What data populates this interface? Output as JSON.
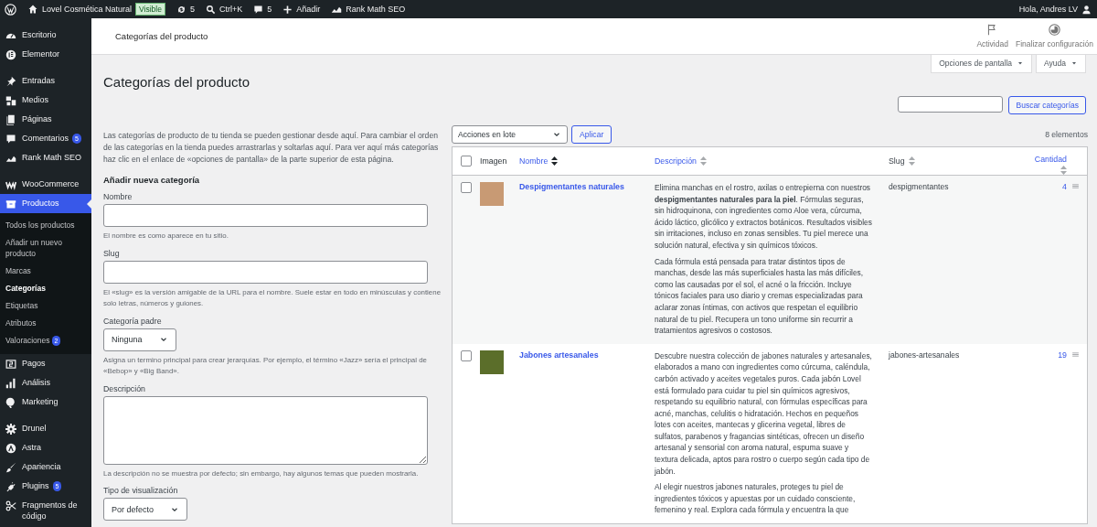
{
  "admin_bar": {
    "site_name": "Lovel Cosmética Natural",
    "site_badge": "Visible",
    "updates": "5",
    "search_shortcut": "Ctrl+K",
    "comments": "5",
    "new_label": "Añadir",
    "seo_label": "Rank Math SEO",
    "greeting": "Hola, Andres LV"
  },
  "sidebar": {
    "groups": [
      [
        {
          "label": "Escritorio",
          "selected": false
        },
        {
          "label": "Elementor",
          "selected": false
        }
      ],
      [
        {
          "label": "Entradas",
          "selected": false
        },
        {
          "label": "Medios",
          "selected": false
        },
        {
          "label": "Páginas",
          "selected": false
        },
        {
          "label": "Comentarios",
          "selected": false,
          "badge": "5"
        },
        {
          "label": "Rank Math SEO",
          "selected": false
        }
      ],
      [
        {
          "label": "WooCommerce",
          "selected": false
        },
        {
          "label": "Productos",
          "selected": true,
          "expanded": true,
          "children": [
            {
              "label": "Todos los productos",
              "selected": false
            },
            {
              "label": "Añadir un nuevo producto",
              "selected": false
            },
            {
              "label": "Marcas",
              "selected": false
            },
            {
              "label": "Categorías",
              "selected": true
            },
            {
              "label": "Etiquetas",
              "selected": false
            },
            {
              "label": "Atributos",
              "selected": false
            },
            {
              "label": "Valoraciones",
              "selected": false,
              "badge": "2"
            }
          ]
        },
        {
          "label": "Pagos",
          "selected": false
        },
        {
          "label": "Análisis",
          "selected": false
        },
        {
          "label": "Marketing",
          "selected": false
        }
      ],
      [
        {
          "label": "Drunel",
          "selected": false
        },
        {
          "label": "Astra",
          "selected": false
        },
        {
          "label": "Apariencia",
          "selected": false
        },
        {
          "label": "Plugins",
          "selected": false,
          "badge": "5"
        },
        {
          "label": "Fragmentos de código",
          "selected": false
        }
      ]
    ]
  },
  "header": {
    "title": "Categorías del producto",
    "actions": [
      {
        "label": "Actividad"
      },
      {
        "label": "Finalizar configuración"
      }
    ]
  },
  "screen_meta": [
    {
      "label": "Opciones de pantalla"
    },
    {
      "label": "Ayuda"
    }
  ],
  "page_title": "Categorías del producto",
  "search": {
    "button": "Buscar categorías"
  },
  "intro": "Las categorías de producto de tu tienda se pueden gestionar desde aquí. Para cambiar el orden de las categorías en la tienda puedes arrastrarlas y soltarlas aquí. Para ver aquí más categorías haz clic en el enlace de «opciones de pantalla» de la parte superior de esta página.",
  "form": {
    "heading": "Añadir nueva categoría",
    "fields": [
      {
        "kind": "text",
        "label": "Nombre",
        "help": "El nombre es como aparece en tu sitio."
      },
      {
        "kind": "text",
        "label": "Slug",
        "help": "El «slug» es la versión amigable de la URL para el nombre. Suele estar en todo en minúsculas y contiene solo letras, números y guiones."
      },
      {
        "kind": "select",
        "label": "Categoría padre",
        "value": "Ninguna",
        "help": "Asigna un termino principal para crear jerarquías. Por ejemplo, el término «Jazz» sería el principal de «Bebop» y «Big Band»."
      },
      {
        "kind": "textarea",
        "label": "Descripción",
        "help": "La descripción no se muestra por defecto; sin embargo, hay algunos temas que pueden mostrarla."
      },
      {
        "kind": "select",
        "label": "Tipo de visualización",
        "value": "Por defecto"
      }
    ]
  },
  "table": {
    "bulk_action": "Acciones en lote",
    "apply": "Aplicar",
    "count": "8 elementos",
    "select_all_checked": false,
    "columns": [
      {
        "label": "Imagen",
        "sortable": false
      },
      {
        "label": "Nombre",
        "sortable": true,
        "sorted": true
      },
      {
        "label": "Descripción",
        "sortable": true,
        "sorted": false
      },
      {
        "label": "Slug",
        "sortable": true,
        "sorted": false
      },
      {
        "label": "Cantidad",
        "sortable": true,
        "sorted": false
      }
    ],
    "rows": [
      {
        "checked": false,
        "name": "Despigmentantes naturales",
        "description": [
          "Elimina manchas en el rostro, axilas o entrepierna con nuestros **despigmentantes naturales para la piel**. Fórmulas seguras, sin hidroquinona, con ingredientes como Aloe vera, cúrcuma, ácido láctico, glicólico y extractos botánicos. Resultados visibles sin irritaciones, incluso en zonas sensibles. Tu piel merece una solución natural, efectiva y sin químicos tóxicos.",
          "Cada fórmula está pensada para tratar distintos tipos de manchas, desde las más superficiales hasta las más difíciles, como las causadas por el sol, el acné o la fricción. Incluye tónicos faciales para uso diario y cremas especializadas para aclarar zonas íntimas, con activos que respetan el equilibrio natural de tu piel. Recupera un tono uniforme sin recurrir a tratamientos agresivos o costosos."
        ],
        "slug": "despigmentantes",
        "count": "4"
      },
      {
        "checked": false,
        "name": "Jabones artesanales",
        "description": [
          "Descubre nuestra colección de jabones naturales y artesanales, elaborados a mano con ingredientes como cúrcuma, caléndula, carbón activado y aceites vegetales puros. Cada jabón Lovel está formulado para cuidar tu piel sin químicos agresivos, respetando su equilibrio natural, con fórmulas específicas para acné, manchas, celulitis o hidratación. Hechos en pequeños lotes con aceites, mantecas y glicerina vegetal, libres de sulfatos, parabenos y fragancias sintéticas, ofrecen un diseño artesanal y sensorial con aroma natural, espuma suave y textura delicada, aptos para rostro o cuerpo según cada tipo de jabón.",
          "Al elegir nuestros jabones naturales, proteges tu piel de ingredientes tóxicos y apuestas por un cuidado consciente, femenino y real. Explora cada fórmula y encuentra la que"
        ],
        "slug": "jabones-artesanales",
        "count": "19"
      }
    ]
  }
}
